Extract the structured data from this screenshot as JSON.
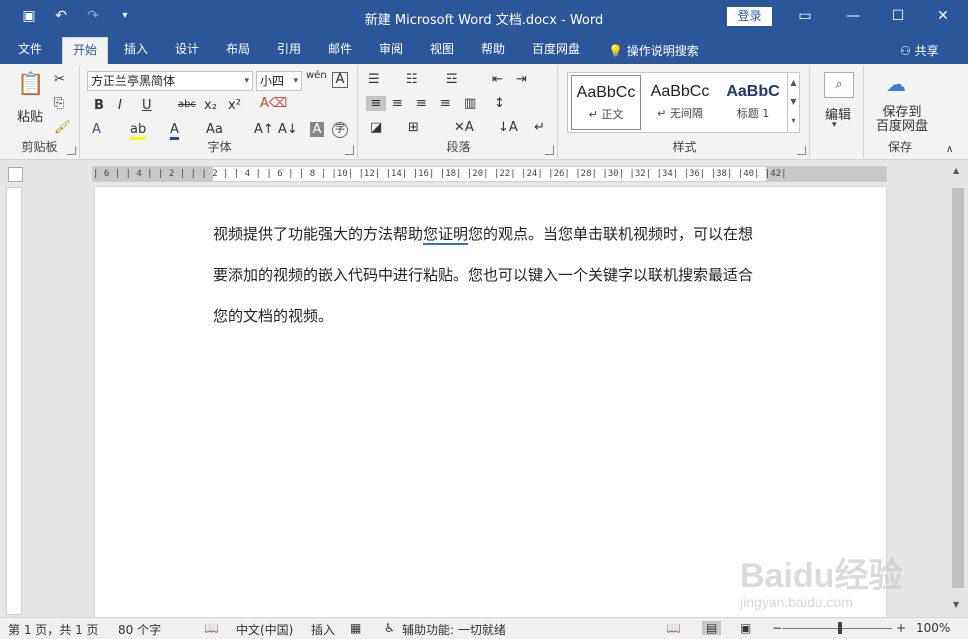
{
  "titlebar": {
    "title": "新建 Microsoft Word 文档.docx  -  Word",
    "login": "登录",
    "save_icon": "save-icon",
    "undo_icon": "undo-icon",
    "redo_icon": "redo-icon",
    "customize_icon": "chevron-down-icon"
  },
  "tabs": [
    "文件",
    "开始",
    "插入",
    "设计",
    "布局",
    "引用",
    "邮件",
    "审阅",
    "视图",
    "帮助",
    "百度网盘"
  ],
  "tellme": "操作说明搜索",
  "share": "共享",
  "ribbon": {
    "clipboard": {
      "label": "剪贴板",
      "paste": "粘贴"
    },
    "font": {
      "label": "字体",
      "name": "方正兰亭黑简体",
      "size": "小四",
      "wen_icon": "wén"
    },
    "paragraph": {
      "label": "段落"
    },
    "styles": {
      "label": "样式",
      "items": [
        {
          "sample": "AaBbCc",
          "name": "↵ 正文"
        },
        {
          "sample": "AaBbCc",
          "name": "↵ 无间隔"
        },
        {
          "sample": "AaBbC",
          "name": "标题 1"
        }
      ]
    },
    "editing": {
      "label": "编辑"
    },
    "save": {
      "label": "保存",
      "button": "保存到\n百度网盘"
    }
  },
  "ruler": "| 6 |  | 4 |  | 2 |     |  | 2 |  | 4 |  | 6 |  | 8 |  |10|  |12|  |14|  |16|  |18|  |20|  |22|  |24|  |26|  |28|  |30|  |32|  |34|  |36|  |38|  |40|  |42|",
  "document": {
    "paragraph_before": "视频提供了功能强大的方法帮助",
    "underlined": "您证明",
    "paragraph_after": "您的观点。当您单击联机视频时，可以在想要添加的视频的嵌入代码中进行粘贴。您也可以键入一个关键字以联机搜索最适合您的文档的视频。"
  },
  "status": {
    "page": "第 1 页，共 1 页",
    "words": "80 个字",
    "language": "中文(中国)",
    "mode": "插入",
    "accessibility": "辅助功能: 一切就绪",
    "zoom": "100%",
    "zoom_level": 1.0
  },
  "watermark": {
    "brand": "Baidu经验",
    "url": "jingyan.baidu.com"
  }
}
